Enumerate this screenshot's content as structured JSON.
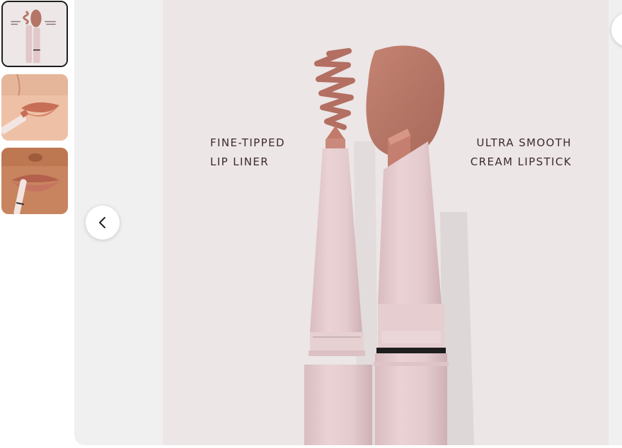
{
  "gallery": {
    "thumbnails": [
      {
        "label": "Lip liner and lipstick product",
        "active": true
      },
      {
        "label": "Model applying lipstick",
        "active": false
      },
      {
        "label": "Model applying lip liner",
        "active": false
      }
    ],
    "captions": {
      "left": [
        "FINE-TIPPED",
        "LIP LINER"
      ],
      "right": [
        "ULTRA SMOOTH",
        "CREAM LIPSTICK"
      ]
    },
    "icons": {
      "prev": "chevron-left-icon",
      "next": "chevron-right-icon"
    },
    "colors": {
      "background": "#ece6e6",
      "case": "#e6cdd0",
      "lip_color": "#b47566",
      "text": "#3e2a2c"
    }
  }
}
